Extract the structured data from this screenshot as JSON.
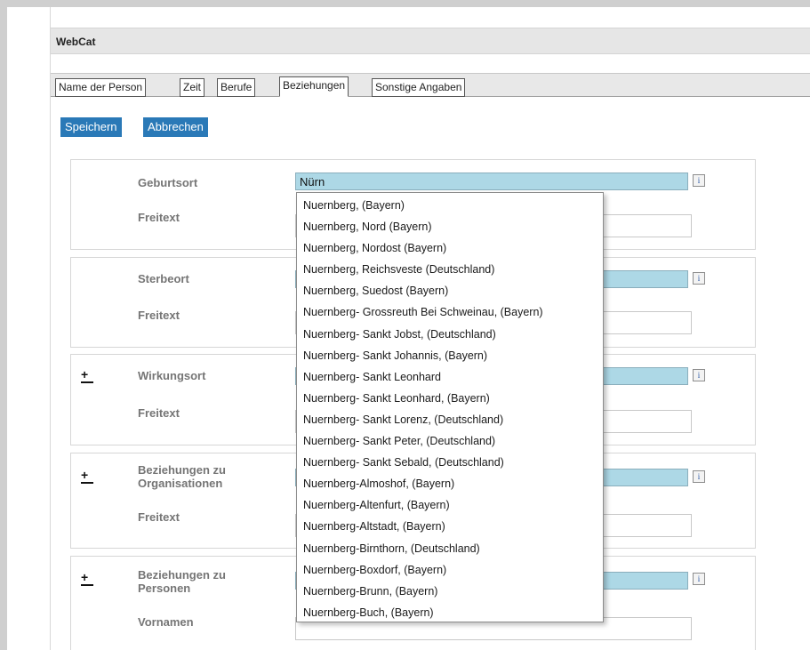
{
  "app": {
    "title": "WebCat"
  },
  "tabs": [
    {
      "label": "Name der Person"
    },
    {
      "label": "Zeit"
    },
    {
      "label": "Berufe"
    },
    {
      "label": "Beziehungen",
      "active": true
    },
    {
      "label": "Sonstige Angaben"
    }
  ],
  "toolbar": {
    "save_label": "Speichern",
    "cancel_label": "Abbrechen"
  },
  "form": {
    "geburtsort": {
      "label": "Geburtsort",
      "value": "Nürn"
    },
    "freitext_label": "Freitext",
    "sterbeort": {
      "label": "Sterbeort",
      "value": ""
    },
    "wirkungsort": {
      "label": "Wirkungsort",
      "value": ""
    },
    "organisationen": {
      "label_line1": "Beziehungen zu",
      "label_line2": "Organisationen",
      "value": ""
    },
    "personen": {
      "label_line1": "Beziehungen zu",
      "label_line2": "Personen",
      "value": ""
    },
    "vornamen_label": "Vornamen",
    "info_glyph": "i",
    "expand_glyph": "+"
  },
  "autocomplete": {
    "items": [
      "Nuernberg, (Bayern)",
      "Nuernberg, Nord (Bayern)",
      "Nuernberg, Nordost (Bayern)",
      "Nuernberg, Reichsveste (Deutschland)",
      "Nuernberg, Suedost (Bayern)",
      "Nuernberg- Grossreuth Bei Schweinau, (Bayern)",
      "Nuernberg- Sankt Jobst, (Deutschland)",
      "Nuernberg- Sankt Johannis, (Bayern)",
      "Nuernberg- Sankt Leonhard",
      "Nuernberg- Sankt Leonhard, (Bayern)",
      "Nuernberg- Sankt Lorenz, (Deutschland)",
      "Nuernberg- Sankt Peter, (Deutschland)",
      "Nuernberg- Sankt Sebald, (Deutschland)",
      "Nuernberg-Almoshof, (Bayern)",
      "Nuernberg-Altenfurt, (Bayern)",
      "Nuernberg-Altstadt, (Bayern)",
      "Nuernberg-Birnthorn, (Deutschland)",
      "Nuernberg-Boxdorf, (Bayern)",
      "Nuernberg-Brunn, (Bayern)",
      "Nuernberg-Buch, (Bayern)"
    ]
  },
  "colors": {
    "accent": "#2a79b7",
    "input_highlight": "#add8e6",
    "label_gray": "#757575"
  }
}
